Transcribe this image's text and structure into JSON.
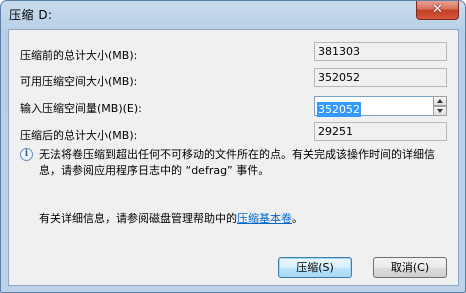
{
  "window": {
    "title": "压缩 D:",
    "close_glyph": "✕"
  },
  "fields": {
    "total_before_label": "压缩前的总计大小(MB):",
    "total_before_value": "381303",
    "available_label": "可用压缩空间大小(MB):",
    "available_value": "352052",
    "shrink_amount_label": "输入压缩空间量(MB)(E):",
    "shrink_amount_value": "352052",
    "total_after_label": "压缩后的总计大小(MB):",
    "total_after_value": "29251"
  },
  "info": {
    "icon": "info-icon",
    "text": "无法将卷压缩到超出任何不可移动的文件所在的点。有关完成该操作时间的详细信息，请参阅应用程序日志中的 “defrag” 事件。"
  },
  "detail": {
    "prefix": "有关详细信息，请参阅磁盘管理帮助中的",
    "link": "压缩基本卷",
    "suffix": "。"
  },
  "buttons": {
    "shrink": "压缩(S)",
    "cancel": "取消(C)"
  },
  "colors": {
    "title_bar": "#bcd2e8",
    "client_bg": "#f0f0f0",
    "selection": "#3399ff",
    "link": "#0066cc",
    "close_button": "#c24226"
  }
}
